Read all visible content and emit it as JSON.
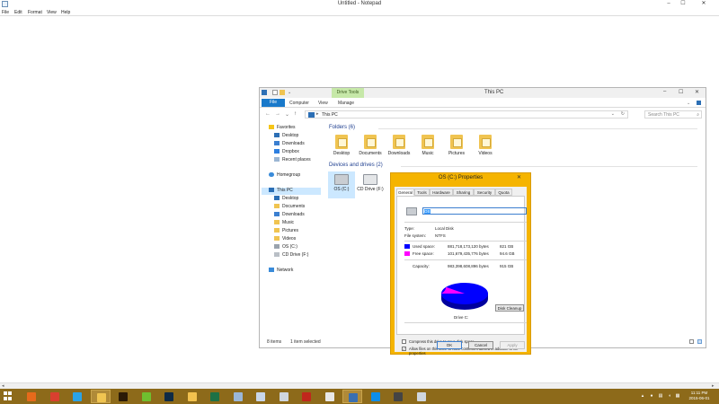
{
  "notepad": {
    "title": "Untitled - Notepad",
    "menu": [
      "File",
      "Edit",
      "Format",
      "View",
      "Help"
    ],
    "controls": {
      "minimize": "–",
      "maximize": "☐",
      "close": "✕"
    }
  },
  "explorer": {
    "title": "This PC",
    "contextual_tab": "Drive Tools",
    "ribbon_tabs": [
      "File",
      "Computer",
      "View",
      "Manage"
    ],
    "address": "This PC",
    "address_sep": "▸",
    "search_placeholder": "Search This PC",
    "nav_glyphs": {
      "back": "←",
      "forward": "→",
      "recent": "⌄",
      "up": "↑",
      "dropdown": "⌄",
      "refresh": "↻",
      "search": "⌕"
    },
    "nav_pane": [
      {
        "label": "Favorites",
        "icon": "star-icon",
        "level": 0
      },
      {
        "label": "Desktop",
        "icon": "desktop-icon",
        "level": 1
      },
      {
        "label": "Downloads",
        "icon": "downloads-icon",
        "level": 1
      },
      {
        "label": "Dropbox",
        "icon": "dropbox-icon",
        "level": 1
      },
      {
        "label": "Recent places",
        "icon": "recent-places-icon",
        "level": 1
      },
      {
        "label": "Homegroup",
        "icon": "homegroup-icon",
        "level": 0
      },
      {
        "label": "This PC",
        "icon": "pc-icon",
        "level": 0,
        "selected": true
      },
      {
        "label": "Desktop",
        "icon": "desktop-icon",
        "level": 1
      },
      {
        "label": "Documents",
        "icon": "documents-icon",
        "level": 1
      },
      {
        "label": "Downloads",
        "icon": "downloads-icon",
        "level": 1
      },
      {
        "label": "Music",
        "icon": "music-icon",
        "level": 1
      },
      {
        "label": "Pictures",
        "icon": "pictures-icon",
        "level": 1
      },
      {
        "label": "Videos",
        "icon": "videos-icon",
        "level": 1
      },
      {
        "label": "OS (C:)",
        "icon": "drive-icon",
        "level": 1
      },
      {
        "label": "CD Drive (F:)",
        "icon": "cd-drive-icon",
        "level": 1
      },
      {
        "label": "Network",
        "icon": "network-icon",
        "level": 0
      }
    ],
    "folders_header": "Folders (6)",
    "folders": [
      "Desktop",
      "Documents",
      "Downloads",
      "Music",
      "Pictures",
      "Videos"
    ],
    "devices_header": "Devices and drives (2)",
    "drives": [
      {
        "label": "OS (C:)",
        "icon": "hard-drive-icon"
      },
      {
        "label": "CD Drive (F:)",
        "icon": "cd-drive-icon"
      }
    ],
    "status_items": "8 items",
    "status_selected": "1 item selected",
    "controls": {
      "minimize": "–",
      "maximize": "☐",
      "close": "✕"
    }
  },
  "properties": {
    "title": "OS (C:) Properties",
    "close": "✕",
    "tabs": [
      "General",
      "Tools",
      "Hardware",
      "Sharing",
      "Security",
      "Quota"
    ],
    "active_tab": "General",
    "label_value": "OS",
    "type_label": "Type:",
    "type_value": "Local Disk",
    "fs_label": "File system:",
    "fs_value": "NTFS",
    "used_label": "Used space:",
    "used_bytes": "881,718,173,120 bytes",
    "used_gb": "821 GB",
    "free_label": "Free space:",
    "free_bytes": "101,679,435,776 bytes",
    "free_gb": "94.6 GB",
    "capacity_label": "Capacity:",
    "capacity_bytes": "983,398,608,896 bytes",
    "capacity_gb": "915 GB",
    "drive_caption": "Drive C:",
    "cleanup_button": "Disk Cleanup",
    "compress_label": "Compress this drive to save disk space",
    "compress_checked": false,
    "index_label": "Allow files on this drive to have contents indexed in addition to file properties",
    "index_checked": true,
    "check_mark": "✓",
    "used_fraction": 0.8966,
    "colors": {
      "used": "#0000ff",
      "free": "#ff00ff"
    },
    "buttons": {
      "ok": "OK",
      "cancel": "Cancel",
      "apply": "Apply"
    }
  },
  "taskbar": {
    "clock_time": "11:11 PM",
    "clock_date": "2015-06-01",
    "apps": [
      {
        "name": "firefox-icon",
        "color": "#e66a1b"
      },
      {
        "name": "chrome-icon",
        "color": "#d9402f"
      },
      {
        "name": "internet-explorer-icon",
        "color": "#2aa3e6"
      },
      {
        "name": "file-explorer-icon",
        "color": "#f0c451",
        "active": true
      },
      {
        "name": "illustrator-icon",
        "color": "#2b1a06"
      },
      {
        "name": "edge-green-icon",
        "color": "#6fbf2f"
      },
      {
        "name": "photoshop-icon",
        "color": "#0f2b46"
      },
      {
        "name": "mail-icon",
        "color": "#f2c14e"
      },
      {
        "name": "excel-icon",
        "color": "#1e7145"
      },
      {
        "name": "quick-app-icon",
        "color": "#9ab7d8"
      },
      {
        "name": "document-icon",
        "color": "#c8d6ea"
      },
      {
        "name": "app-icon",
        "color": "#cfd6de"
      },
      {
        "name": "filezilla-icon",
        "color": "#c0271c"
      },
      {
        "name": "app2-icon",
        "color": "#e8e8e8"
      },
      {
        "name": "remote-desktop-icon",
        "color": "#3a6fb0",
        "active": true
      },
      {
        "name": "teamviewer-icon",
        "color": "#0e8ee9"
      },
      {
        "name": "app3-icon",
        "color": "#444444"
      },
      {
        "name": "alien-icon",
        "color": "#cfd6de"
      }
    ]
  }
}
